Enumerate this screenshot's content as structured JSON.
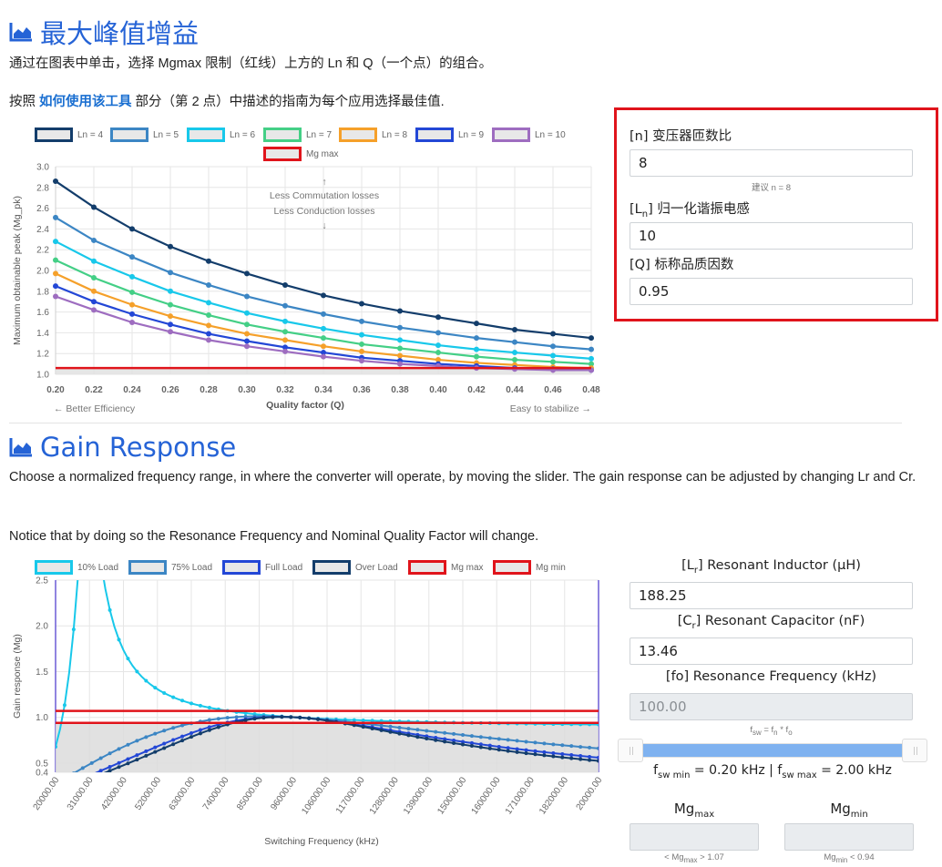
{
  "section1": {
    "title": "最大峰值增益",
    "desc": "通过在图表中单击，选择 Mgmax 限制（红线）上方的 Ln 和 Q（一个点）的组合。",
    "guide_prefix": "按照 ",
    "guide_link": "如何使用该工具",
    "guide_suffix": " 部分（第 2 点）中描述的指南为每个应用选择最佳值."
  },
  "params1": {
    "n_label": "[n] 变压器匝数比",
    "n_value": "8",
    "n_hint": "建议 n = 8",
    "ln_label_pre": "[L",
    "ln_label_sub": "n",
    "ln_label_post": "] 归一化谐振电感",
    "ln_value": "10",
    "q_label": "[Q] 标称品质因数",
    "q_value": "0.95",
    "highlight_color": "#e0141b"
  },
  "chart1_annotations": {
    "top1": "Less Commutation losses",
    "top2": "Less Conduction losses",
    "bottom_left": "← Better Efficiency",
    "bottom_right": "Easy to stabilize →",
    "arrow_up": "↑",
    "arrow_down": "↓"
  },
  "section2": {
    "title": "Gain Response",
    "desc1": "Choose a normalized frequency range, in where the converter will operate, by moving the slider. The gain response can be adjusted by changing Lr and Cr.",
    "desc2": "Notice that by doing so the Resonance Frequency and Nominal Quality Factor will change."
  },
  "params2": {
    "lr_label_pre": "[L",
    "lr_label_sub": "r",
    "lr_label_post": "] Resonant Inductor (μH)",
    "lr_value": "188.25",
    "cr_label_pre": "[C",
    "cr_label_sub": "r",
    "cr_label_post": "] Resonant Capacitor (nF)",
    "cr_value": "13.46",
    "fo_label": "[fo] Resonance Frequency (kHz)",
    "fo_value": "100.00",
    "fsw_hint_pre": "f",
    "fsw_hint_sub1": "sw",
    "fsw_hint_mid": " = f",
    "fsw_hint_sub2": "n",
    "fsw_hint_mid2": " * f",
    "fsw_hint_sub3": "o",
    "slider_min_fraction": 0.0,
    "slider_max_fraction": 1.0,
    "range_f": "f",
    "range_sub1": "sw min",
    "range_mid": " = 0.20 kHz | f",
    "range_sub2": "sw max",
    "range_end": " = 2.00 kHz",
    "mgmax_label": "Mg",
    "mgmax_sub": "max",
    "mgmin_label": "Mg",
    "mgmin_sub": "min",
    "mgmax_hint_pre": "< Mg",
    "mgmax_hint_sub": "max",
    "mgmax_hint_post": " > 1.07",
    "mgmin_hint_pre": "Mg",
    "mgmin_hint_sub": "min",
    "mgmin_hint_post": " < 0.94",
    "slider_color": "#7fb2f0"
  },
  "chart_data": [
    {
      "type": "line",
      "xlabel": "Quality factor (Q)",
      "ylabel": "Maximum obtainable peak (Mg_pk)",
      "x": [
        0.2,
        0.22,
        0.24,
        0.26,
        0.28,
        0.3,
        0.32,
        0.34,
        0.36,
        0.38,
        0.4,
        0.42,
        0.44,
        0.46,
        0.48
      ],
      "xlim": [
        0.2,
        0.48
      ],
      "ylim": [
        1.0,
        3.0
      ],
      "yticks": [
        1.0,
        1.2,
        1.4,
        1.6,
        1.8,
        2.0,
        2.2,
        2.4,
        2.6,
        2.8,
        3.0
      ],
      "grid": true,
      "legend_position": "top",
      "series": [
        {
          "name": "Ln = 4",
          "color": "#133d6b",
          "values": [
            2.86,
            2.61,
            2.4,
            2.23,
            2.09,
            1.97,
            1.86,
            1.76,
            1.68,
            1.61,
            1.55,
            1.49,
            1.43,
            1.39,
            1.35
          ]
        },
        {
          "name": "Ln = 5",
          "color": "#3c86c4",
          "values": [
            2.51,
            2.29,
            2.13,
            1.98,
            1.86,
            1.75,
            1.66,
            1.58,
            1.51,
            1.45,
            1.4,
            1.35,
            1.31,
            1.27,
            1.24
          ]
        },
        {
          "name": "Ln = 6",
          "color": "#18c8ea",
          "values": [
            2.28,
            2.09,
            1.94,
            1.8,
            1.69,
            1.59,
            1.51,
            1.44,
            1.38,
            1.33,
            1.28,
            1.24,
            1.21,
            1.18,
            1.15
          ]
        },
        {
          "name": "Ln = 7",
          "color": "#44cf86",
          "values": [
            2.1,
            1.93,
            1.79,
            1.67,
            1.57,
            1.48,
            1.41,
            1.35,
            1.29,
            1.25,
            1.21,
            1.17,
            1.14,
            1.12,
            1.1
          ]
        },
        {
          "name": "Ln = 8",
          "color": "#f5a02a",
          "values": [
            1.97,
            1.8,
            1.67,
            1.56,
            1.47,
            1.39,
            1.33,
            1.27,
            1.22,
            1.18,
            1.14,
            1.11,
            1.09,
            1.07,
            1.06
          ]
        },
        {
          "name": "Ln = 9",
          "color": "#2347d6",
          "values": [
            1.85,
            1.7,
            1.58,
            1.48,
            1.39,
            1.32,
            1.26,
            1.21,
            1.16,
            1.13,
            1.1,
            1.08,
            1.06,
            1.05,
            1.04
          ]
        },
        {
          "name": "Ln = 10",
          "color": "#9e6dc0",
          "values": [
            1.75,
            1.62,
            1.5,
            1.41,
            1.33,
            1.27,
            1.22,
            1.17,
            1.13,
            1.1,
            1.08,
            1.06,
            1.05,
            1.04,
            1.04
          ]
        },
        {
          "name": "Mg max",
          "color": "#e0141b",
          "values": [
            1.06,
            1.06,
            1.06,
            1.06,
            1.06,
            1.06,
            1.06,
            1.06,
            1.06,
            1.06,
            1.06,
            1.06,
            1.06,
            1.06,
            1.06
          ]
        }
      ]
    },
    {
      "type": "line",
      "xlabel": "Switching Frequency (kHz)",
      "ylabel": "Gain response (Mg)",
      "xtick_labels": [
        "20000.00",
        "31000.00",
        "42000.00",
        "52000.00",
        "63000.00",
        "74000.00",
        "85000.00",
        "96000.00",
        "106000.00",
        "117000.00",
        "128000.00",
        "139000.00",
        "150000.00",
        "160000.00",
        "171000.00",
        "182000.00",
        "20000.00"
      ],
      "ylim": [
        0.4,
        2.5
      ],
      "yticks": [
        0.4,
        0.5,
        1.0,
        1.5,
        2.0,
        2.5
      ],
      "grid": true,
      "legend_position": "top",
      "series": [
        {
          "name": "10% Load",
          "color": "#18c8ea"
        },
        {
          "name": "75% Load",
          "color": "#3c86c4"
        },
        {
          "name": "Full Load",
          "color": "#2347d6"
        },
        {
          "name": "Over Load",
          "color": "#133d6b"
        },
        {
          "name": "Mg max",
          "color": "#e0141b",
          "value": 1.07
        },
        {
          "name": "Mg min",
          "color": "#e0141b",
          "value": 0.94
        }
      ]
    }
  ]
}
